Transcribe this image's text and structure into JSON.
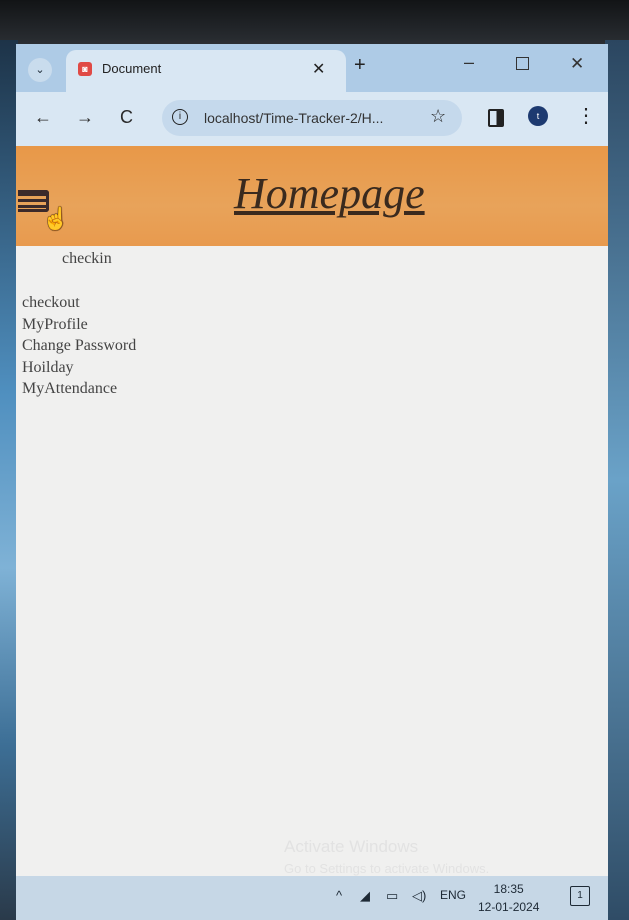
{
  "browser": {
    "tab_search_glyph": "⌄",
    "tab": {
      "title": "Document",
      "favicon": "document-favicon",
      "close_glyph": "✕"
    },
    "new_tab_glyph": "+",
    "window_controls": {
      "minimize": "–",
      "close": "✕"
    },
    "nav": {
      "back": "←",
      "forward": "→",
      "reload": "C"
    },
    "address": "localhost/Time-Tracker-2/H...",
    "site_info_glyph": "i",
    "bookmark_glyph": "☆",
    "profile_initial": "t",
    "menu_glyph": "⋮"
  },
  "page": {
    "title": "Homepage",
    "checkin_label": "checkin",
    "menu_items": [
      "checkout",
      "MyProfile",
      "Change Password",
      "Hoilday",
      "MyAttendance"
    ],
    "watermark": {
      "line1": "Activate Windows",
      "line2": "Go to Settings to activate Windows."
    },
    "header_color": "#e89848"
  },
  "taskbar": {
    "language": "ENG",
    "time": "18:35",
    "date": "12-01-2024",
    "notification_count": "1"
  }
}
